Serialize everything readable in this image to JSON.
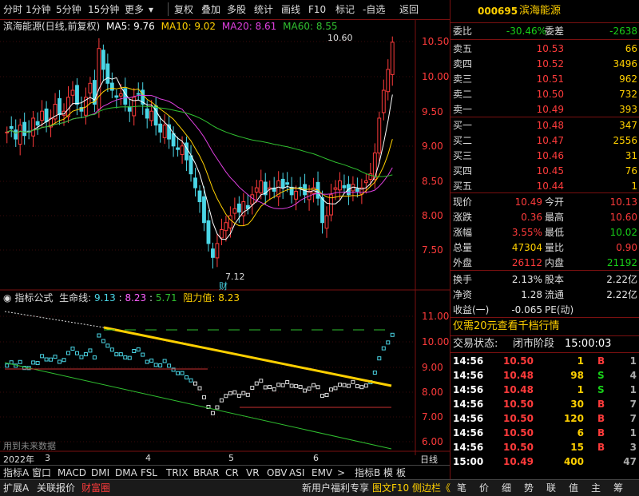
{
  "toolbar": {
    "items": [
      "分时",
      "1分钟",
      "5分钟",
      "15分钟",
      "更多",
      "复权",
      "叠加",
      "多股",
      "统计",
      "画线",
      "F10",
      "标记",
      "-自选",
      "返回"
    ]
  },
  "header": {
    "stock_title": "滨海能源(日线,前复权)",
    "ma5": "MA5: 9.76",
    "ma10": "MA10: 9.02",
    "ma20": "MA20: 8.61",
    "ma60": "MA60: 8.55"
  },
  "price_axis": [
    "10.50",
    "10.00",
    "9.50",
    "9.00",
    "8.50",
    "8.00",
    "7.50"
  ],
  "annotations": {
    "high": "10.60",
    "low": "7.12",
    "fin": "财"
  },
  "indicator": {
    "name": "指标公式",
    "line_name": "生命线:",
    "v1": "9.13",
    "v2": "8.23",
    "v3": "5.71",
    "res_name": "阻力值:",
    "res": "8.23",
    "note": "用到未来数据"
  },
  "ind_axis": [
    "11.00",
    "10.00",
    "9.00",
    "8.00",
    "7.00",
    "6.00"
  ],
  "date_axis": {
    "year": "2022年",
    "m3": "3",
    "m4": "4",
    "m5": "5",
    "m6": "6",
    "period": "日线"
  },
  "tabs": [
    "指标A",
    "窗口",
    "MACD",
    "DMI",
    "DMA",
    "FSL",
    "TRIX",
    "BRAR",
    "CR",
    "VR",
    "OBV",
    "ASI",
    "EMV",
    ">",
    "指标B",
    "模",
    "板"
  ],
  "quote": {
    "code": "000695",
    "name": "滨海能源",
    "weibi_label": "委比",
    "weibi": "-30.46%",
    "weicha_label": "委差",
    "weicha": "-2638",
    "asks": [
      {
        "l": "卖五",
        "p": "10.53",
        "v": "66"
      },
      {
        "l": "卖四",
        "p": "10.52",
        "v": "3496"
      },
      {
        "l": "卖三",
        "p": "10.51",
        "v": "962"
      },
      {
        "l": "卖二",
        "p": "10.50",
        "v": "732"
      },
      {
        "l": "卖一",
        "p": "10.49",
        "v": "393"
      }
    ],
    "bids": [
      {
        "l": "买一",
        "p": "10.48",
        "v": "347"
      },
      {
        "l": "买二",
        "p": "10.47",
        "v": "2556"
      },
      {
        "l": "买三",
        "p": "10.46",
        "v": "31"
      },
      {
        "l": "买四",
        "p": "10.45",
        "v": "76"
      },
      {
        "l": "买五",
        "p": "10.44",
        "v": "1"
      }
    ],
    "stats": [
      {
        "l1": "现价",
        "v1": "10.49",
        "l2": "今开",
        "v2": "10.13"
      },
      {
        "l1": "涨跌",
        "v1": "0.36",
        "l2": "最高",
        "v2": "10.60"
      },
      {
        "l1": "涨幅",
        "v1": "3.55%",
        "l2": "最低",
        "v2": "10.02"
      },
      {
        "l1": "总量",
        "v1": "47304",
        "l2": "量比",
        "v2": "0.90"
      },
      {
        "l1": "外盘",
        "v1": "26112",
        "l2": "内盘",
        "v2": "21192"
      }
    ],
    "stats2": [
      {
        "l1": "换手",
        "v1": "2.13%",
        "l2": "股本",
        "v2": "2.22亿"
      },
      {
        "l1": "净资",
        "v1": "1.28",
        "l2": "流通",
        "v2": "2.22亿"
      },
      {
        "l1": "收益(一)",
        "v1": "-0.065",
        "l2": "PE(动)",
        "v2": ""
      }
    ],
    "promo": "仅需20元查看千档行情",
    "status_label": "交易状态:",
    "status": "闭市阶段",
    "status_time": "15:00:03",
    "trades": [
      {
        "t": "14:56",
        "p": "10.50",
        "v": "1",
        "d": "B",
        "n": "1"
      },
      {
        "t": "14:56",
        "p": "10.48",
        "v": "98",
        "d": "S",
        "n": "4"
      },
      {
        "t": "14:56",
        "p": "10.48",
        "v": "1",
        "d": "S",
        "n": "1"
      },
      {
        "t": "14:56",
        "p": "10.50",
        "v": "30",
        "d": "B",
        "n": "7"
      },
      {
        "t": "14:56",
        "p": "10.50",
        "v": "120",
        "d": "B",
        "n": "7"
      },
      {
        "t": "14:56",
        "p": "10.50",
        "v": "6",
        "d": "B",
        "n": "1"
      },
      {
        "t": "14:56",
        "p": "10.50",
        "v": "15",
        "d": "B",
        "n": "3"
      },
      {
        "t": "15:00",
        "p": "10.49",
        "v": "400",
        "d": "",
        "n": "47"
      }
    ]
  },
  "bottom": {
    "left": [
      "扩展A",
      "关联报价",
      "财富圈"
    ],
    "mid": [
      "新用户福利专享",
      "图文F10",
      "侧边栏《"
    ],
    "right": [
      "笔",
      "价",
      "细",
      "势",
      "联",
      "值",
      "主",
      "筹"
    ]
  },
  "colors": {
    "up": "#ff3b3b",
    "down": "#18d018",
    "cyan": "#4ad6e6",
    "ma5": "#ffffff",
    "ma10": "#ffd000",
    "ma20": "#e040e0",
    "ma60": "#30c030",
    "border": "#7a1010"
  }
}
